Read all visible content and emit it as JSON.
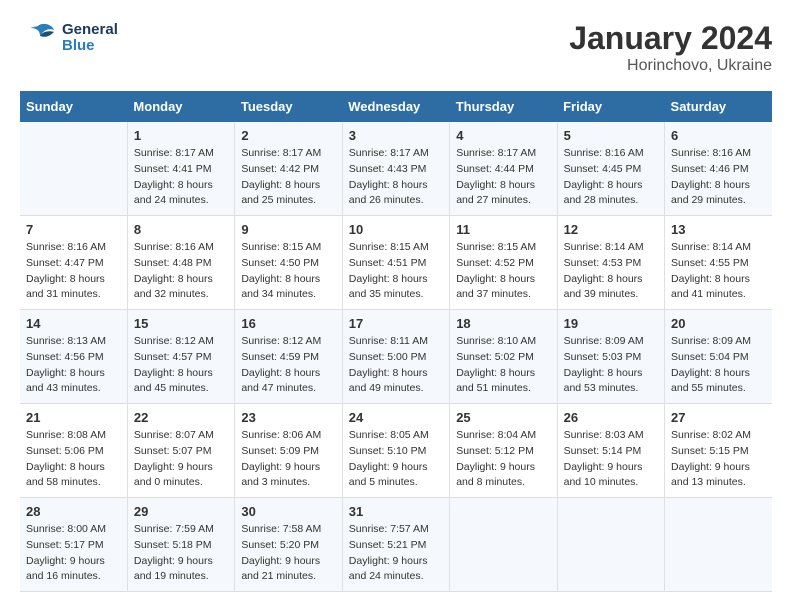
{
  "logo": {
    "line1": "General",
    "line2": "Blue"
  },
  "title": "January 2024",
  "subtitle": "Horinchovo, Ukraine",
  "weekdays": [
    "Sunday",
    "Monday",
    "Tuesday",
    "Wednesday",
    "Thursday",
    "Friday",
    "Saturday"
  ],
  "weeks": [
    [
      {
        "day": "",
        "sunrise": "",
        "sunset": "",
        "daylight": ""
      },
      {
        "day": "1",
        "sunrise": "Sunrise: 8:17 AM",
        "sunset": "Sunset: 4:41 PM",
        "daylight": "Daylight: 8 hours and 24 minutes."
      },
      {
        "day": "2",
        "sunrise": "Sunrise: 8:17 AM",
        "sunset": "Sunset: 4:42 PM",
        "daylight": "Daylight: 8 hours and 25 minutes."
      },
      {
        "day": "3",
        "sunrise": "Sunrise: 8:17 AM",
        "sunset": "Sunset: 4:43 PM",
        "daylight": "Daylight: 8 hours and 26 minutes."
      },
      {
        "day": "4",
        "sunrise": "Sunrise: 8:17 AM",
        "sunset": "Sunset: 4:44 PM",
        "daylight": "Daylight: 8 hours and 27 minutes."
      },
      {
        "day": "5",
        "sunrise": "Sunrise: 8:16 AM",
        "sunset": "Sunset: 4:45 PM",
        "daylight": "Daylight: 8 hours and 28 minutes."
      },
      {
        "day": "6",
        "sunrise": "Sunrise: 8:16 AM",
        "sunset": "Sunset: 4:46 PM",
        "daylight": "Daylight: 8 hours and 29 minutes."
      }
    ],
    [
      {
        "day": "7",
        "sunrise": "Sunrise: 8:16 AM",
        "sunset": "Sunset: 4:47 PM",
        "daylight": "Daylight: 8 hours and 31 minutes."
      },
      {
        "day": "8",
        "sunrise": "Sunrise: 8:16 AM",
        "sunset": "Sunset: 4:48 PM",
        "daylight": "Daylight: 8 hours and 32 minutes."
      },
      {
        "day": "9",
        "sunrise": "Sunrise: 8:15 AM",
        "sunset": "Sunset: 4:50 PM",
        "daylight": "Daylight: 8 hours and 34 minutes."
      },
      {
        "day": "10",
        "sunrise": "Sunrise: 8:15 AM",
        "sunset": "Sunset: 4:51 PM",
        "daylight": "Daylight: 8 hours and 35 minutes."
      },
      {
        "day": "11",
        "sunrise": "Sunrise: 8:15 AM",
        "sunset": "Sunset: 4:52 PM",
        "daylight": "Daylight: 8 hours and 37 minutes."
      },
      {
        "day": "12",
        "sunrise": "Sunrise: 8:14 AM",
        "sunset": "Sunset: 4:53 PM",
        "daylight": "Daylight: 8 hours and 39 minutes."
      },
      {
        "day": "13",
        "sunrise": "Sunrise: 8:14 AM",
        "sunset": "Sunset: 4:55 PM",
        "daylight": "Daylight: 8 hours and 41 minutes."
      }
    ],
    [
      {
        "day": "14",
        "sunrise": "Sunrise: 8:13 AM",
        "sunset": "Sunset: 4:56 PM",
        "daylight": "Daylight: 8 hours and 43 minutes."
      },
      {
        "day": "15",
        "sunrise": "Sunrise: 8:12 AM",
        "sunset": "Sunset: 4:57 PM",
        "daylight": "Daylight: 8 hours and 45 minutes."
      },
      {
        "day": "16",
        "sunrise": "Sunrise: 8:12 AM",
        "sunset": "Sunset: 4:59 PM",
        "daylight": "Daylight: 8 hours and 47 minutes."
      },
      {
        "day": "17",
        "sunrise": "Sunrise: 8:11 AM",
        "sunset": "Sunset: 5:00 PM",
        "daylight": "Daylight: 8 hours and 49 minutes."
      },
      {
        "day": "18",
        "sunrise": "Sunrise: 8:10 AM",
        "sunset": "Sunset: 5:02 PM",
        "daylight": "Daylight: 8 hours and 51 minutes."
      },
      {
        "day": "19",
        "sunrise": "Sunrise: 8:09 AM",
        "sunset": "Sunset: 5:03 PM",
        "daylight": "Daylight: 8 hours and 53 minutes."
      },
      {
        "day": "20",
        "sunrise": "Sunrise: 8:09 AM",
        "sunset": "Sunset: 5:04 PM",
        "daylight": "Daylight: 8 hours and 55 minutes."
      }
    ],
    [
      {
        "day": "21",
        "sunrise": "Sunrise: 8:08 AM",
        "sunset": "Sunset: 5:06 PM",
        "daylight": "Daylight: 8 hours and 58 minutes."
      },
      {
        "day": "22",
        "sunrise": "Sunrise: 8:07 AM",
        "sunset": "Sunset: 5:07 PM",
        "daylight": "Daylight: 9 hours and 0 minutes."
      },
      {
        "day": "23",
        "sunrise": "Sunrise: 8:06 AM",
        "sunset": "Sunset: 5:09 PM",
        "daylight": "Daylight: 9 hours and 3 minutes."
      },
      {
        "day": "24",
        "sunrise": "Sunrise: 8:05 AM",
        "sunset": "Sunset: 5:10 PM",
        "daylight": "Daylight: 9 hours and 5 minutes."
      },
      {
        "day": "25",
        "sunrise": "Sunrise: 8:04 AM",
        "sunset": "Sunset: 5:12 PM",
        "daylight": "Daylight: 9 hours and 8 minutes."
      },
      {
        "day": "26",
        "sunrise": "Sunrise: 8:03 AM",
        "sunset": "Sunset: 5:14 PM",
        "daylight": "Daylight: 9 hours and 10 minutes."
      },
      {
        "day": "27",
        "sunrise": "Sunrise: 8:02 AM",
        "sunset": "Sunset: 5:15 PM",
        "daylight": "Daylight: 9 hours and 13 minutes."
      }
    ],
    [
      {
        "day": "28",
        "sunrise": "Sunrise: 8:00 AM",
        "sunset": "Sunset: 5:17 PM",
        "daylight": "Daylight: 9 hours and 16 minutes."
      },
      {
        "day": "29",
        "sunrise": "Sunrise: 7:59 AM",
        "sunset": "Sunset: 5:18 PM",
        "daylight": "Daylight: 9 hours and 19 minutes."
      },
      {
        "day": "30",
        "sunrise": "Sunrise: 7:58 AM",
        "sunset": "Sunset: 5:20 PM",
        "daylight": "Daylight: 9 hours and 21 minutes."
      },
      {
        "day": "31",
        "sunrise": "Sunrise: 7:57 AM",
        "sunset": "Sunset: 5:21 PM",
        "daylight": "Daylight: 9 hours and 24 minutes."
      },
      {
        "day": "",
        "sunrise": "",
        "sunset": "",
        "daylight": ""
      },
      {
        "day": "",
        "sunrise": "",
        "sunset": "",
        "daylight": ""
      },
      {
        "day": "",
        "sunrise": "",
        "sunset": "",
        "daylight": ""
      }
    ]
  ]
}
